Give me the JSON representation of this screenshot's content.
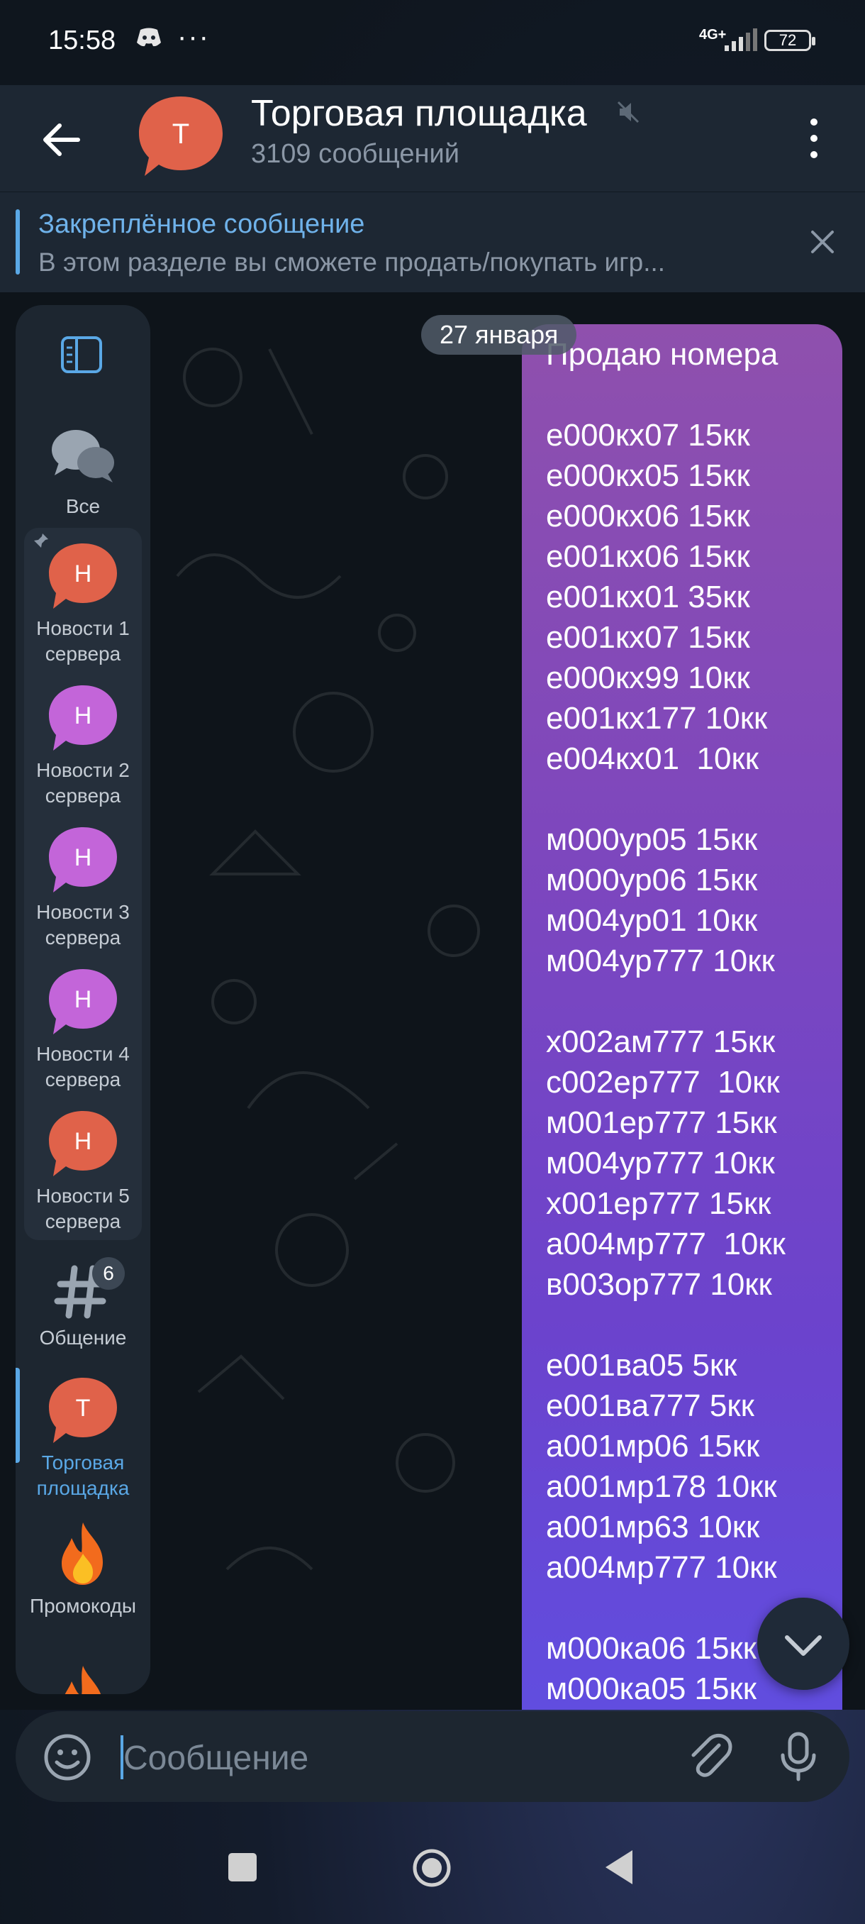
{
  "status_bar": {
    "time": "15:58",
    "dots": "···",
    "network": "4G+",
    "battery": "72"
  },
  "header": {
    "title": "Торговая площадка",
    "subtitle": "3109 сообщений",
    "avatar_letter": "Т"
  },
  "pinned": {
    "title": "Закреплённое сообщение",
    "text": "В этом разделе вы сможете продать/покупать игр..."
  },
  "chat": {
    "date": "27 января",
    "message": "Продаю номера\n\nе000кх07 15кк\nе000кх05 15кк\nе000кх06 15кк\nе001кх06 15кк\nе001кх01 35кк\nе001кх07 15кк\nе000кх99 10кк\nе001кх177 10кк\nе004кх01  10кк\n\nм000ур05 15кк\nм000ур06 15кк\nм004ур01 10кк\nм004ур777 10кк\n\nх002ам777 15кк\nс002ер777  10кк\nм001ер777 15кк\nм004ур777 10кк\nх001ер777 15кк\nа004мр777  10кк\nв003ор777 10кк\n\nе001ва05 5кк\nе001ва777 5кк\nа001мр06 15кк\nа001мр178 10кк\nа001мр63 10кк\nа004мр777 10кк\n\nм000ка06 15кк\nм000ка05 15кк"
  },
  "sidebar": {
    "all_label": "Все",
    "items": [
      {
        "letter": "Н",
        "label": "Новости 1 сервера",
        "color": "#e0624a"
      },
      {
        "letter": "Н",
        "label": "Новости 2 сервера",
        "color": "#c365d9"
      },
      {
        "letter": "Н",
        "label": "Новости 3 сервера",
        "color": "#c365d9"
      },
      {
        "letter": "Н",
        "label": "Новости 4 сервера",
        "color": "#c365d9"
      },
      {
        "letter": "Н",
        "label": "Новости 5 сервера",
        "color": "#e0624a"
      }
    ],
    "general": {
      "label": "Общение",
      "badge": "6"
    },
    "trade": {
      "letter": "Т",
      "label": "Торговая площадка"
    },
    "promo": {
      "label": "Промокоды",
      "icon": "fire-icon"
    }
  },
  "input": {
    "placeholder": "Сообщение"
  },
  "colors": {
    "accent": "#5aa8e6",
    "header": "#1d2733",
    "bubble_top": "#8f50ad",
    "bubble_bottom": "#5f4fe2"
  }
}
